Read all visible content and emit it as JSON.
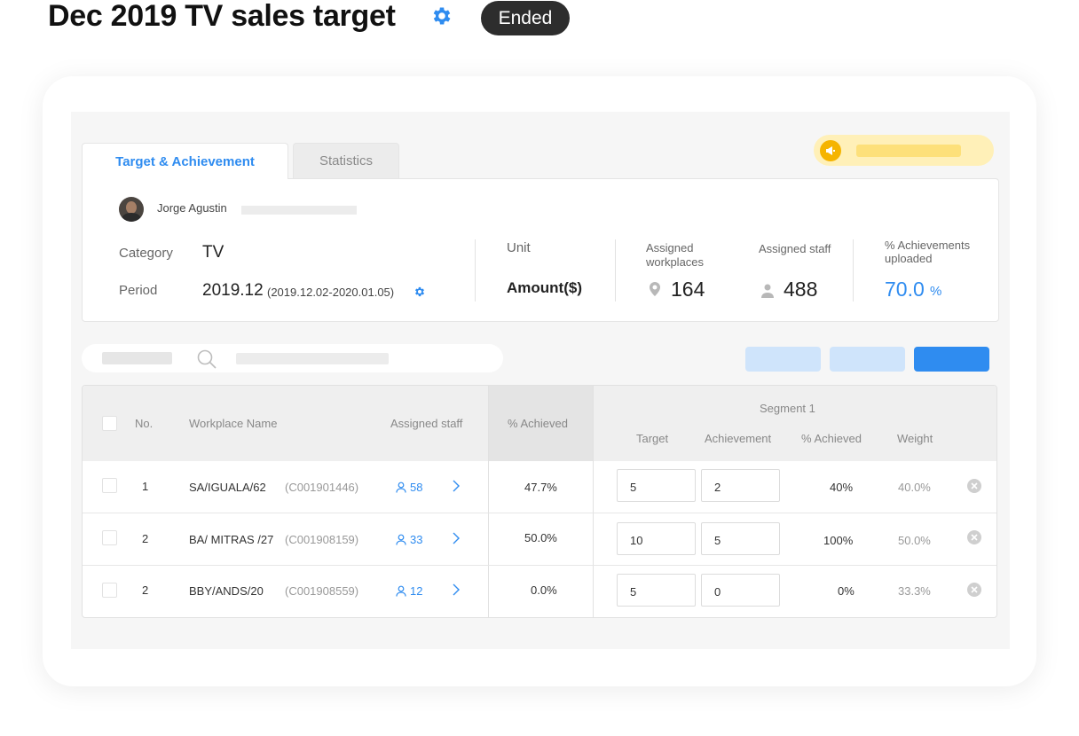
{
  "header": {
    "title": "Dec 2019 TV sales target",
    "status": "Ended"
  },
  "tabs": [
    {
      "label": "Target & Achievement",
      "active": true
    },
    {
      "label": "Statistics",
      "active": false
    }
  ],
  "summary": {
    "user_name": "Jorge Agustin",
    "category_label": "Category",
    "category_value": "TV",
    "period_label": "Period",
    "period_value": "2019.12",
    "period_range": "(2019.12.02-2020.01.05)",
    "unit_label": "Unit",
    "unit_value": "Amount($)",
    "workplaces_label": "Assigned workplaces",
    "workplaces_value": "164",
    "staff_label": "Assigned staff",
    "staff_value": "488",
    "uploaded_label": "% Achievements uploaded",
    "uploaded_value": "70.0",
    "uploaded_unit": "%"
  },
  "table": {
    "headers": {
      "no": "No.",
      "workplace": "Workplace Name",
      "staff": "Assigned staff",
      "achieved": "% Achieved",
      "segment": "Segment 1",
      "target": "Target",
      "achievement": "Achievement",
      "seg_achieved": "% Achieved",
      "weight": "Weight"
    },
    "rows": [
      {
        "no": "1",
        "name": "SA/IGUALA/62",
        "code": "(C001901446)",
        "staff": "58",
        "achieved": "47.7%",
        "target": "5",
        "achievement": "2",
        "seg_achieved": "40%",
        "weight": "40.0%"
      },
      {
        "no": "2",
        "name": "BA/ MITRAS /27",
        "code": "(C001908159)",
        "staff": "33",
        "achieved": "50.0%",
        "target": "10",
        "achievement": "5",
        "seg_achieved": "100%",
        "weight": "50.0%"
      },
      {
        "no": "2",
        "name": "BBY/ANDS/20",
        "code": "(C001908559)",
        "staff": "12",
        "achieved": "0.0%",
        "target": "5",
        "achievement": "0",
        "seg_achieved": "0%",
        "weight": "33.3%"
      }
    ]
  },
  "colors": {
    "accent": "#2f8cf0",
    "badge": "#2d2d2d",
    "notice": "#fff0b8"
  },
  "icons": [
    "gear-icon",
    "megaphone-icon",
    "location-pin-icon",
    "person-icon",
    "search-icon",
    "user-outline-icon",
    "chevron-right-icon",
    "remove-icon"
  ]
}
